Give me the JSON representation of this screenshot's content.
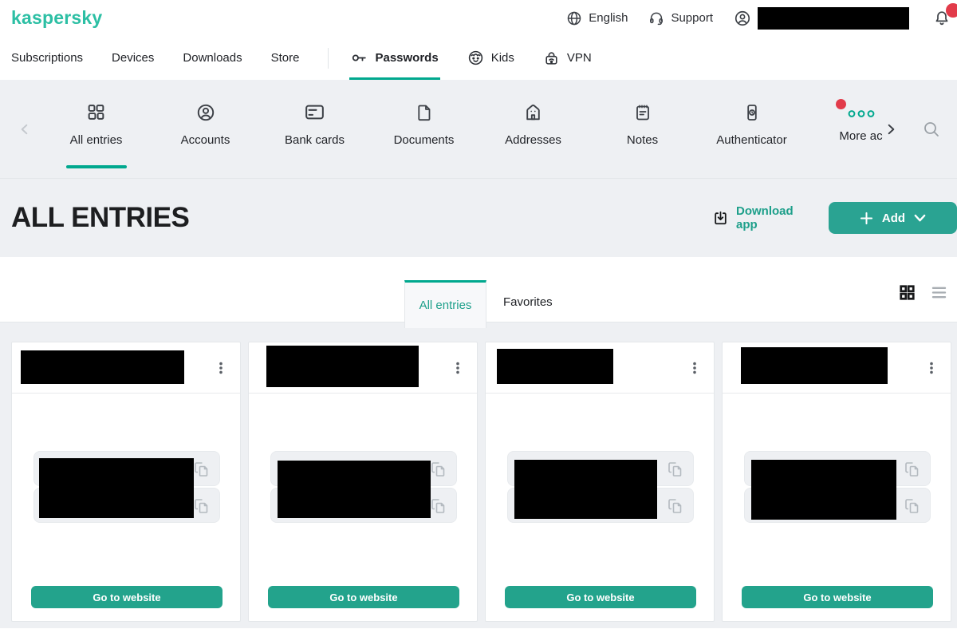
{
  "brand": {
    "logo": "kaspersky"
  },
  "header": {
    "language_label": "English",
    "support_label": "Support",
    "notification_badge": true
  },
  "nav": {
    "subscriptions": "Subscriptions",
    "devices": "Devices",
    "downloads": "Downloads",
    "store": "Store",
    "passwords": "Passwords",
    "kids": "Kids",
    "vpn": "VPN",
    "active_item": "Passwords"
  },
  "categories": {
    "all_entries": "All entries",
    "accounts": "Accounts",
    "bank_cards": "Bank cards",
    "documents": "Documents",
    "addresses": "Addresses",
    "notes": "Notes",
    "authenticator": "Authenticator",
    "more": "More ac",
    "active_item": "All entries",
    "more_has_badge": true
  },
  "page": {
    "title": "ALL ENTRIES",
    "download_app": "Download app",
    "add": "Add"
  },
  "tabs": {
    "all_entries": "All entries",
    "favorites": "Favorites",
    "active_tab": "All entries"
  },
  "cards": {
    "count": 4,
    "action_label": "Go to website",
    "title_redacted": true,
    "values_redacted": true,
    "fields_per_card": 2
  },
  "icons": [
    "globe-icon",
    "headset-icon",
    "user-icon",
    "bell-icon",
    "key-icon",
    "kid-icon",
    "vpn-lock-icon",
    "grid-category-icon",
    "account-icon",
    "bank-card-icon",
    "document-icon",
    "house-icon",
    "notes-icon",
    "authenticator-icon",
    "more-dots-icon",
    "chevron-left-icon",
    "chevron-right-icon",
    "search-icon",
    "download-icon",
    "plus-icon",
    "chevron-down-icon",
    "kebab-icon",
    "copy-icon",
    "grid-view-icon",
    "list-view-icon"
  ],
  "colors": {
    "brand_teal": "#2cbfa4",
    "accent_teal": "#00a88e",
    "button_teal": "#2aa392",
    "badge_red": "#e23b4a",
    "page_gray": "#eef0f3"
  }
}
